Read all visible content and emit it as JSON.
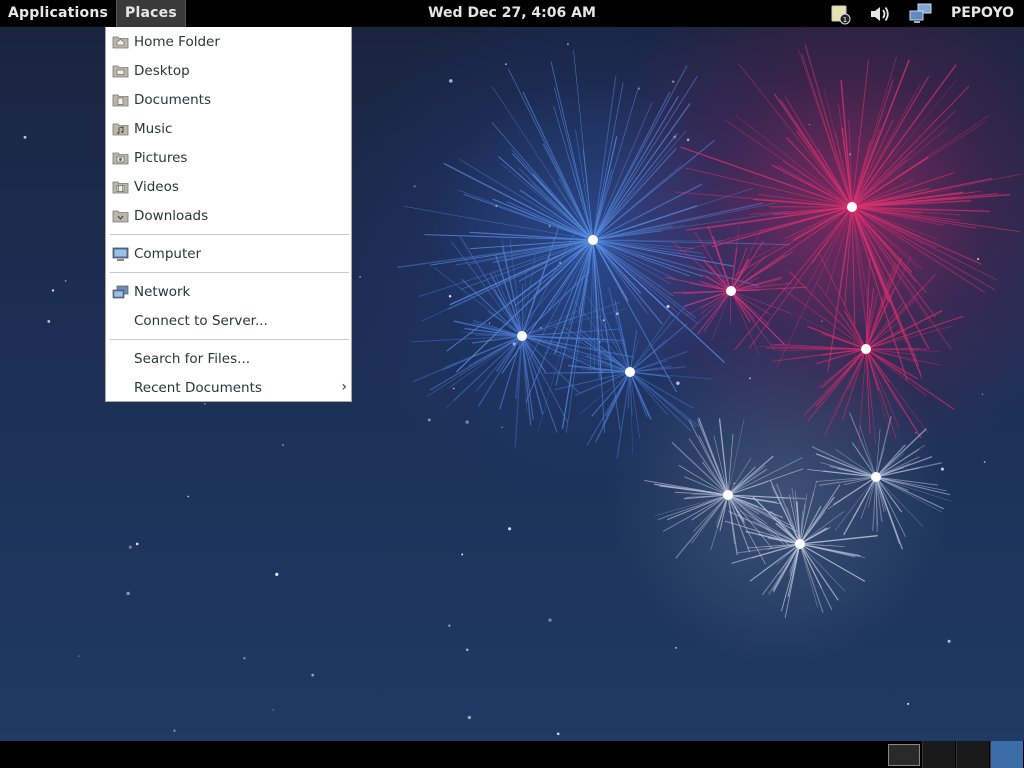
{
  "top_panel": {
    "applications_label": "Applications",
    "places_label": "Places",
    "clock": "Wed Dec 27,  4:06 AM",
    "notification_icon": "notification-icon",
    "volume_icon": "volume-icon",
    "network_icon": "network-icon",
    "username": "PEPOYO"
  },
  "places_menu": {
    "items": [
      {
        "label": "Home Folder",
        "icon": "home-folder-icon"
      },
      {
        "label": "Desktop",
        "icon": "desktop-folder-icon"
      },
      {
        "label": "Documents",
        "icon": "documents-folder-icon"
      },
      {
        "label": "Music",
        "icon": "music-folder-icon"
      },
      {
        "label": "Pictures",
        "icon": "pictures-folder-icon"
      },
      {
        "label": "Videos",
        "icon": "videos-folder-icon"
      },
      {
        "label": "Downloads",
        "icon": "downloads-folder-icon"
      },
      {
        "label": "Computer",
        "icon": "computer-icon"
      },
      {
        "label": "Network",
        "icon": "network-icon"
      },
      {
        "label": "Connect to Server...",
        "icon": ""
      },
      {
        "label": "Search for Files...",
        "icon": ""
      },
      {
        "label": "Recent Documents",
        "icon": "",
        "submenu_arrow": "›"
      }
    ]
  },
  "bottom_panel": {
    "workspace_count": 4,
    "active_workspace": 4
  },
  "colors": {
    "panel": "#000000",
    "menu_bg": "#ffffff",
    "active_workspace": "#3b6ea8"
  }
}
